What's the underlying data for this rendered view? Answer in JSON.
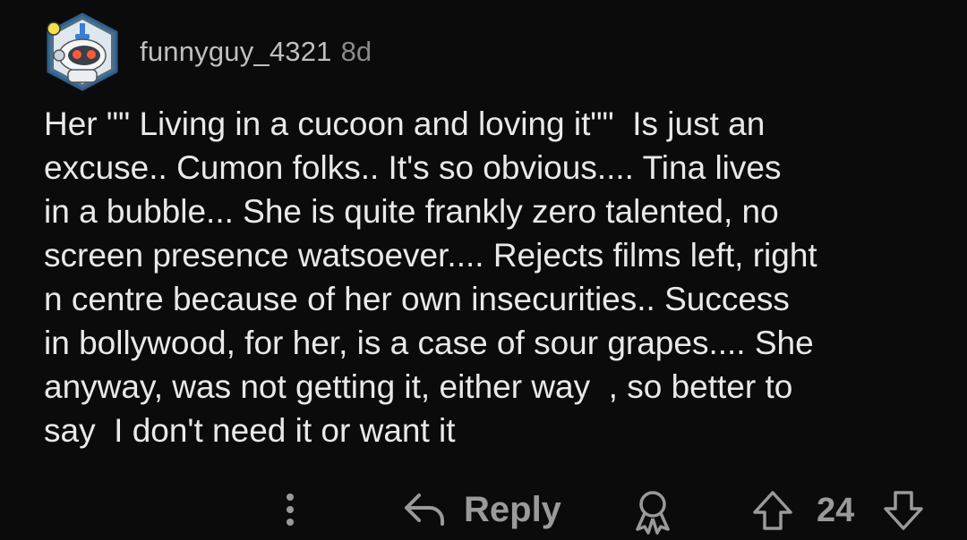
{
  "comment": {
    "author": "funnyguy_4321",
    "age": "8d",
    "text": "Her \"\" Living in a cucoon and loving it\"\"  Is just an\nexcuse.. Cumon folks.. It's so obvious.... Tina lives\nin a bubble... She is quite frankly zero talented, no\nscreen presence watsoever.... Rejects films left, right\nn centre because of her own insecurities.. Success\nin bollywood, for her, is a case of sour grapes.... She\nanyway, was not getting it, either way  , so better to\nsay  I don't need it or want it"
  },
  "actions": {
    "more_icon": "vertical-dots-icon",
    "reply_icon": "reply-arrow-icon",
    "reply_label": "Reply",
    "award_icon": "award-icon",
    "upvote_icon": "upvote-arrow-icon",
    "score": "24",
    "downvote_icon": "downvote-arrow-icon"
  },
  "colors": {
    "background": "#0b0b0b",
    "text": "#e9e9e9",
    "muted": "#9a9a9a",
    "avatar_ring": "#3f7fb8"
  }
}
